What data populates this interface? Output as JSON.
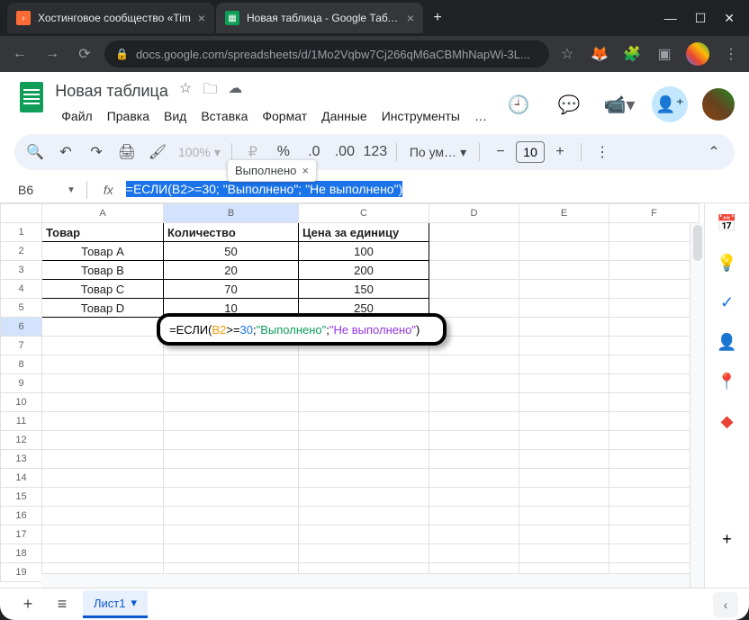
{
  "browser": {
    "tabs": [
      {
        "title": "Хостинговое сообщество «Tim",
        "icon": "orange"
      },
      {
        "title": "Новая таблица - Google Табли",
        "icon": "green"
      }
    ],
    "url": "docs.google.com/spreadsheets/d/1Mo2Vqbw7Cj266qM6aCBMhNapWi-3L..."
  },
  "doc": {
    "title": "Новая таблица",
    "menu": [
      "Файл",
      "Правка",
      "Вид",
      "Вставка",
      "Формат",
      "Данные",
      "Инструменты",
      "…"
    ]
  },
  "toolbar": {
    "zoom": "100%",
    "font": "По ум…",
    "font_size": "10",
    "tooltip": "Выполнено"
  },
  "formula": {
    "cell": "B6",
    "text": "=ЕСЛИ(B2>=30; \"Выполнено\"; \"Не выполнено\")",
    "parts": {
      "eq": "=",
      "func": "ЕСЛИ",
      "ref": "B2",
      "op": ">=",
      "num": "30",
      "sep": "; ",
      "str1": "\"Выполнено\"",
      "str2": "\"Не выполнено\""
    }
  },
  "sheet": {
    "columns": [
      "A",
      "B",
      "C",
      "D",
      "E",
      "F"
    ],
    "headers": {
      "a": "Товар",
      "b": "Количество",
      "c": "Цена за единицу"
    },
    "rows": [
      {
        "a": "Товар A",
        "b": "50",
        "c": "100"
      },
      {
        "a": "Товар B",
        "b": "20",
        "c": "200"
      },
      {
        "a": "Товар C",
        "b": "70",
        "c": "150"
      },
      {
        "a": "Товар D",
        "b": "10",
        "c": "250"
      }
    ],
    "tab_name": "Лист1"
  }
}
